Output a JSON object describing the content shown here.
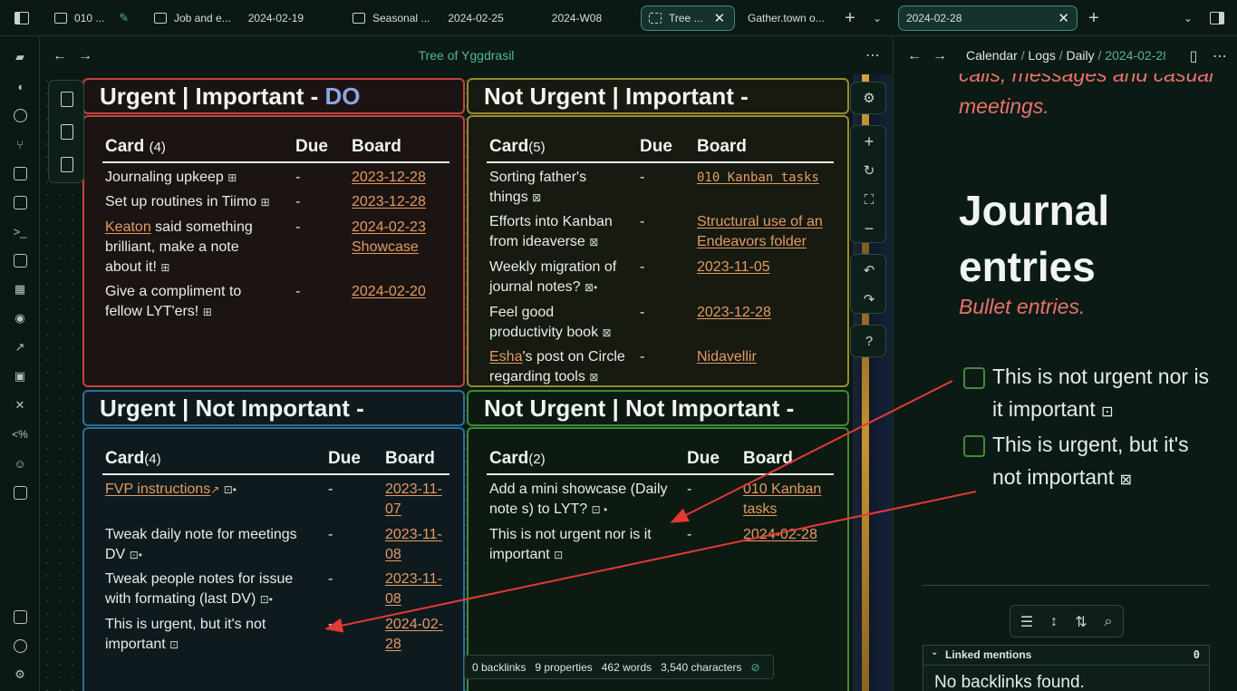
{
  "tabs": [
    {
      "label": "010 ..."
    },
    {
      "label": "Job and e...",
      "date": "2024-02-19"
    },
    {
      "label": "Seasonal ...",
      "date": "2024-02-25",
      "extra": "2024-W08"
    },
    {
      "label": "Tree ..."
    },
    {
      "label": "Gather.town o..."
    },
    {
      "label": "2024-02-28"
    }
  ],
  "main": {
    "title": "Tree of Yggdrasil"
  },
  "quadrants": {
    "q1": {
      "title": "Urgent | Important - ",
      "title_accent": "DO",
      "col_card": "Card",
      "count": "(4)",
      "col_due": "Due",
      "col_board": "Board",
      "rows": [
        {
          "card": "Journaling upkeep",
          "due": "-",
          "board": "2023-12-28"
        },
        {
          "card": "Set up routines in Tiimo",
          "due": "-",
          "board": "2023-12-28"
        },
        {
          "card_link": "Keaton",
          "card": " said something brilliant, make a note about it!",
          "due": "-",
          "board": "2024-02-23 Showcase"
        },
        {
          "card": "Give a compliment to fellow LYT'ers!",
          "due": "-",
          "board": "2024-02-20"
        }
      ]
    },
    "q2": {
      "title": "Not Urgent | Important -",
      "col_card": "Card",
      "count": "(5)",
      "col_due": "Due",
      "col_board": "Board",
      "rows": [
        {
          "card": "Sorting father's things",
          "due": "-",
          "board": "010 Kanban tasks"
        },
        {
          "card": "Efforts into Kanban from ideaverse",
          "due": "-",
          "board": "Structural use of an Endeavors folder"
        },
        {
          "card": "Weekly migration of journal notes?",
          "due": "-",
          "board": "2023-11-05"
        },
        {
          "card": "Feel good productivity book",
          "due": "-",
          "board": "2023-12-28"
        },
        {
          "card_link": "Esha",
          "card": "'s post on Circle regarding tools",
          "due": "-",
          "board": "Nidavellir"
        }
      ]
    },
    "q3": {
      "title": "Urgent | Not Important -",
      "col_card": "Card",
      "count": "(4)",
      "col_due": "Due",
      "col_board": "Board",
      "rows": [
        {
          "card_link": "FVP instructions",
          "card": "",
          "due": "-",
          "board": "2023-11-07"
        },
        {
          "card": "Tweak daily note for meetings DV",
          "due": "-",
          "board": "2023-11-08"
        },
        {
          "card": "Tweak people notes for issue with formating (last DV)",
          "due": "-",
          "board": "2023-11-08"
        },
        {
          "card": "This is urgent, but it's not important",
          "due": "-",
          "board": "2024-02-28"
        }
      ]
    },
    "q4": {
      "title": "Not Urgent | Not Important -",
      "col_card": "Card",
      "count": "(2)",
      "col_due": "Due",
      "col_board": "Board",
      "rows": [
        {
          "card": "Add a mini showcase (Daily note s) to LYT?",
          "due": "-",
          "board": "010 Kanban tasks"
        },
        {
          "card": "This is not urgent nor is it important",
          "due": "-",
          "board": "2024-02-28"
        }
      ]
    }
  },
  "status": {
    "backlinks": "0 backlinks",
    "properties": "9 properties",
    "words": "462 words",
    "characters": "3,540 characters"
  },
  "right": {
    "breadcrumb": [
      "Calendar",
      "Logs",
      "Daily"
    ],
    "breadcrumb_current": "2024-02-28",
    "italic_top1": "calls, messages and casual",
    "italic_top2": "meetings.",
    "heading_line1": "Journal",
    "heading_line2": "entries",
    "subtitle": "Bullet entries.",
    "tasks": [
      {
        "line1": "This is not urgent nor is",
        "line2": "it important"
      },
      {
        "line1": "This is urgent, but it's",
        "line2": "not important"
      }
    ],
    "linked_mentions": "Linked mentions",
    "linked_count": "0",
    "no_backlinks": "No backlinks found."
  },
  "colors": {
    "accent": "#3f8a77",
    "link": "#e39a64",
    "do": "#8ea4e6",
    "q1": "#c3433f",
    "q2": "#9a8a2e",
    "q3": "#2f6e9c",
    "q4": "#3f8a3a",
    "arrow": "#e23a36",
    "italic": "#e9716a"
  }
}
